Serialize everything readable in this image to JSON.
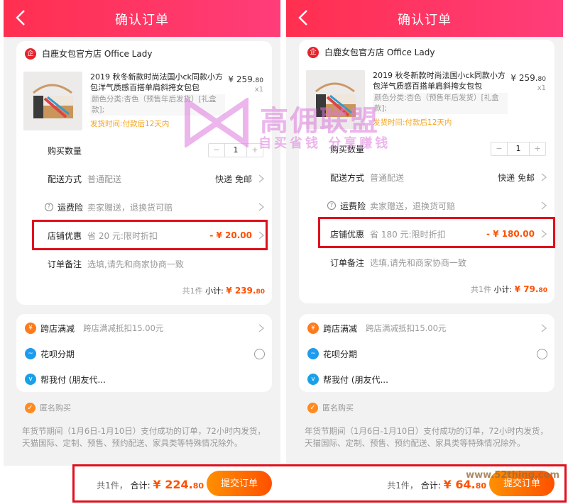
{
  "screens": [
    {
      "header": {
        "title": "确认订单"
      },
      "shop": {
        "name": "白鹿女包官方店 Office Lady",
        "logo_text": "企"
      },
      "product": {
        "name": "2019 秋冬新款时尚法国小ck同款小方包洋气质感百搭单肩斜挎女包包",
        "spec": "颜色分类:杏色（预售年后发货）[礼盒款];",
        "ship_time": "发货时间:付款后12天内",
        "price_int": "¥ 259.",
        "price_dec": "80",
        "qty_text": "x1"
      },
      "rows": {
        "qty": {
          "label": "购买数量",
          "value": "1",
          "minus": "−",
          "plus": "+"
        },
        "delivery": {
          "label": "配送方式",
          "value": "普通配送",
          "right": "快递 免邮"
        },
        "insurance": {
          "label": "运费险",
          "value": "卖家赠送，退换货可赔",
          "q": "?"
        },
        "store_discount": {
          "label": "店铺优惠",
          "value": "省 20 元:限时折扣",
          "right": "- ¥ 20.00"
        },
        "remark": {
          "label": "订单备注",
          "value": "选填,请先和商家协商一致"
        }
      },
      "subtotal": {
        "count": "共1件",
        "label": "小计:",
        "amount_int": "¥ 239.",
        "amount_dec": "80"
      },
      "payments": [
        {
          "label": "跨店满减",
          "desc": "跨店满减抵扣15.00元",
          "icon": "¥",
          "color": "#ff7a1a"
        },
        {
          "label": "花呗分期",
          "desc": "",
          "icon": "~",
          "color": "#1d9bf0"
        },
        {
          "label": "帮我付 (朋友代...",
          "desc": "",
          "icon": "v",
          "color": "#1aa0e8"
        }
      ],
      "anonymous": {
        "label": "匿名购买",
        "check": "✓"
      },
      "notice": "年货节期间（1月6日-1月10日）支付成功的订单，72小时内发货，天猫国际、定制、预售、预约配送、家具类等特殊情况除外。",
      "bottom": {
        "count": "共1件，",
        "label": "合计:",
        "amount_int": "¥ 224.",
        "amount_dec": "80",
        "submit": "提交订单"
      }
    },
    {
      "header": {
        "title": "确认订单"
      },
      "shop": {
        "name": "白鹿女包官方店 Office Lady",
        "logo_text": "企"
      },
      "product": {
        "name": "2019 秋冬新款时尚法国小ck同款小方包洋气质感百搭单肩斜挎女包包",
        "spec": "颜色分类:杏色（预售年后发货）[礼盒款];",
        "ship_time": "发货时间:付款后12天内",
        "price_int": "¥ 259.",
        "price_dec": "80",
        "qty_text": "x1"
      },
      "rows": {
        "qty": {
          "label": "购买数量",
          "value": "1",
          "minus": "−",
          "plus": "+"
        },
        "delivery": {
          "label": "配送方式",
          "value": "普通配送",
          "right": "快递 免邮"
        },
        "insurance": {
          "label": "运费险",
          "value": "卖家赠送，退换货可赔",
          "q": "?"
        },
        "store_discount": {
          "label": "店铺优惠",
          "value": "省 180 元:限时折扣",
          "right": "- ¥ 180.00"
        },
        "remark": {
          "label": "订单备注",
          "value": "选填,请先和商家协商一致"
        }
      },
      "subtotal": {
        "count": "共1件",
        "label": "小计:",
        "amount_int": "¥ 79.",
        "amount_dec": "80"
      },
      "payments": [
        {
          "label": "跨店满减",
          "desc": "跨店满减抵扣15.00元",
          "icon": "¥",
          "color": "#ff7a1a"
        },
        {
          "label": "花呗分期",
          "desc": "",
          "icon": "~",
          "color": "#1d9bf0"
        },
        {
          "label": "帮我付 (朋友代...",
          "desc": "",
          "icon": "v",
          "color": "#1aa0e8"
        }
      ],
      "anonymous": {
        "label": "匿名购买",
        "check": "✓"
      },
      "notice": "年货节期间（1月6日-1月10日）支付成功的订单，72小时内发货，天猫国际、定制、预售、预约配送、家具类等特殊情况除外。",
      "bottom": {
        "count": "共1件，",
        "label": "合计:",
        "amount_int": "¥ 64.",
        "amount_dec": "80",
        "submit": "提交订单"
      }
    }
  ],
  "watermark": {
    "title": "高佣联盟",
    "subtitle": "自买省钱 分享赚钱",
    "color": "#dc78dc"
  },
  "corner_watermark": "www.52thing.com",
  "highlight_color": "#e0101c"
}
